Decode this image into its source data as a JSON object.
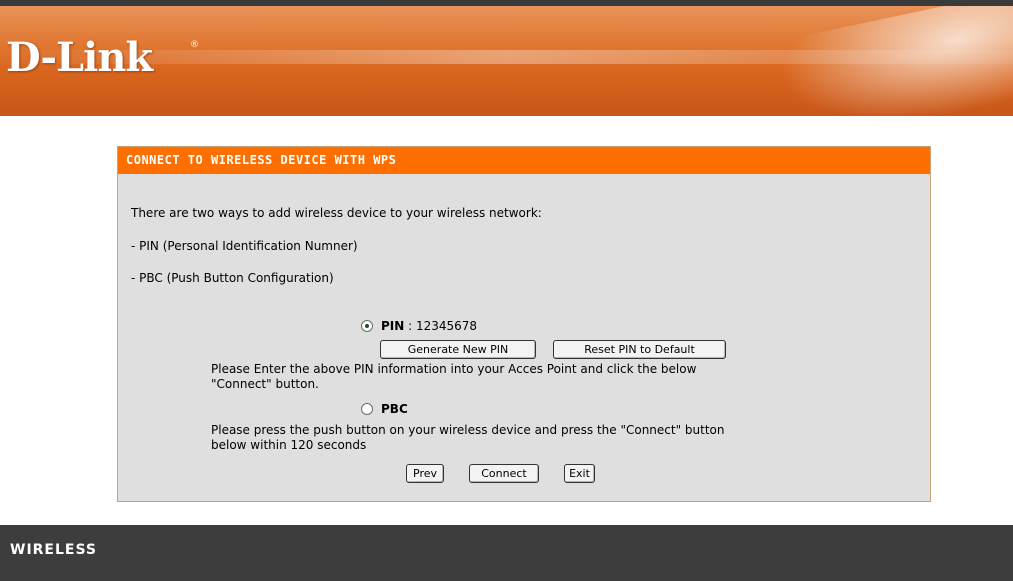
{
  "brand": {
    "logo": "D-Link",
    "reg": "®"
  },
  "panel": {
    "title": "CONNECT TO WIRELESS DEVICE WITH WPS",
    "intro": "There are two ways to add wireless device to your wireless network:",
    "method_pin": "- PIN (Personal Identification Numner)",
    "method_pbc": "- PBC (Push Button Configuration)"
  },
  "pin": {
    "label": "PIN",
    "separator": " : ",
    "value": "12345678",
    "selected": true,
    "generate_button": "Generate New PIN",
    "reset_button": "Reset PIN to Default",
    "instruction_line1": "Please Enter the above PIN information into your Acces Point and click the below",
    "instruction_line2": "\"Connect\" button."
  },
  "pbc": {
    "label": "PBC",
    "selected": false,
    "instruction_line1": "Please press the push button on your wireless device and press the \"Connect\" button",
    "instruction_line2": "below within 120 seconds"
  },
  "actions": {
    "prev": "Prev",
    "connect": "Connect",
    "exit": "Exit"
  },
  "footer": {
    "label": "WIRELESS"
  },
  "colors": {
    "header_orange": "#ff6f00",
    "panel_bg": "#dfdfdf",
    "footer_bg": "#3d3d3d"
  }
}
